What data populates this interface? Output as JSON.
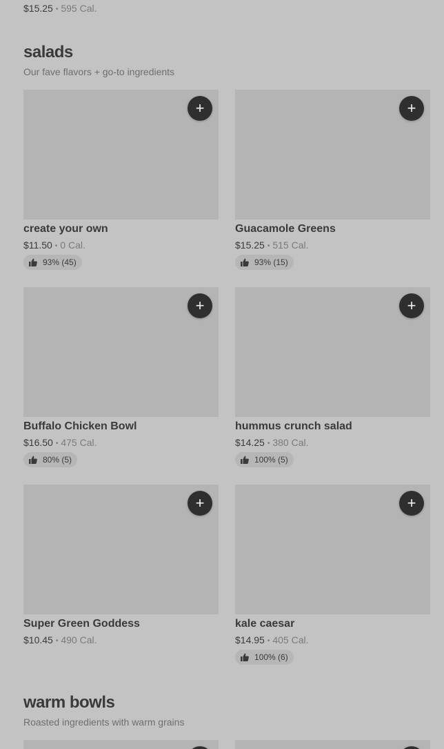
{
  "previous_item": {
    "price": "$15.25",
    "cal": "595 Cal."
  },
  "salads": {
    "title": "salads",
    "subtitle": "Our fave flavors + go-to ingredients",
    "items": [
      {
        "name": "create your own",
        "price": "$11.50",
        "cal": "0 Cal.",
        "rating": "93% (45)"
      },
      {
        "name": "Guacamole Greens",
        "price": "$15.25",
        "cal": "515 Cal.",
        "rating": "93% (15)"
      },
      {
        "name": "Buffalo Chicken Bowl",
        "price": "$16.50",
        "cal": "475 Cal.",
        "rating": "80% (5)"
      },
      {
        "name": "hummus crunch salad",
        "price": "$14.25",
        "cal": "380 Cal.",
        "rating": "100% (5)"
      },
      {
        "name": "Super Green Goddess",
        "price": "$10.45",
        "cal": "490 Cal.",
        "rating": null
      },
      {
        "name": "kale caesar",
        "price": "$14.95",
        "cal": "405 Cal.",
        "rating": "100% (6)"
      }
    ]
  },
  "warm_bowls": {
    "title": "warm bowls",
    "subtitle": "Roasted ingredients with warm grains"
  },
  "icons": {
    "add": "plus-icon",
    "rating": "thumbs-up-icon"
  },
  "add_button_label": "+"
}
